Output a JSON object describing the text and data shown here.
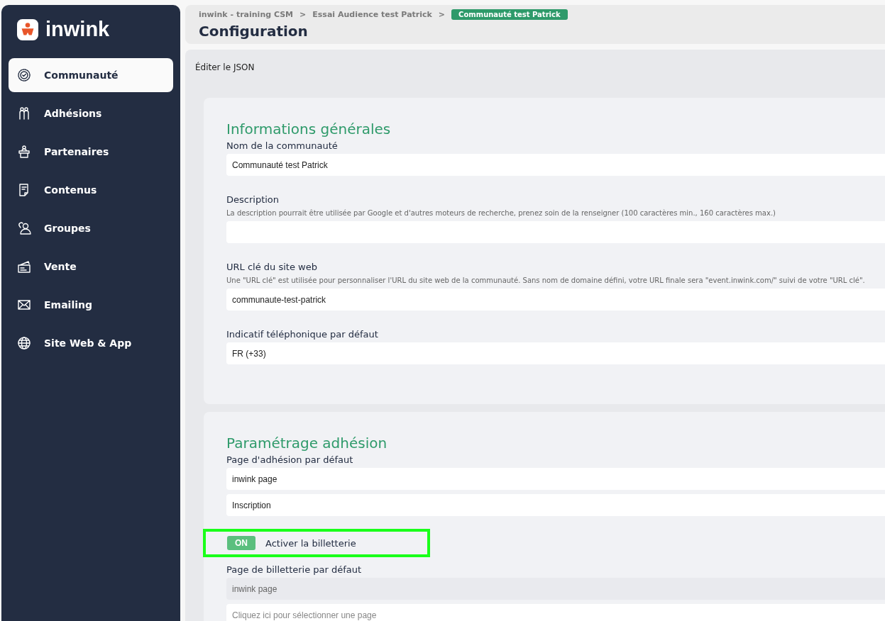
{
  "brand": {
    "name": "inwink"
  },
  "sidebar": {
    "items": [
      {
        "label": "Communauté",
        "selected": true
      },
      {
        "label": "Adhésions",
        "selected": false
      },
      {
        "label": "Partenaires",
        "selected": false
      },
      {
        "label": "Contenus",
        "selected": false
      },
      {
        "label": "Groupes",
        "selected": false
      },
      {
        "label": "Vente",
        "selected": false
      },
      {
        "label": "Emailing",
        "selected": false
      },
      {
        "label": "Site Web & App",
        "selected": false
      }
    ]
  },
  "breadcrumb": [
    {
      "label": "inwink - training CSM",
      "current": false
    },
    {
      "label": "Essai Audience test Patrick",
      "current": false
    },
    {
      "label": "Communauté test Patrick",
      "current": true
    }
  ],
  "breadcrumb_separator": ">",
  "page_title": "Configuration",
  "edit_json_link": "Éditer le JSON",
  "sections": [
    {
      "title": "Informations générales",
      "items": [
        {
          "kind": "field",
          "label": "Nom de la communauté",
          "inputs": [
            {
              "value": "Communauté test Patrick",
              "disabled": false
            }
          ]
        },
        {
          "kind": "field",
          "label": "Description",
          "hint": "La description pourrait être utilisée par Google et d'autres moteurs de recherche, prenez soin de la renseigner (100 caractères min., 160 caractères max.)",
          "inputs": [
            {
              "disabled": false
            }
          ]
        },
        {
          "kind": "field",
          "label": "URL clé du site web",
          "hint": "Une \"URL clé\" est utilisée pour personnaliser l'URL du site web de la communauté. Sans nom de domaine défini, votre URL finale sera \"event.inwink.com/\" suivi de votre \"URL clé\".",
          "inputs": [
            {
              "value": "communaute-test-patrick",
              "disabled": false
            }
          ]
        },
        {
          "kind": "field",
          "label": "Indicatif téléphonique par défaut",
          "inputs": [
            {
              "value": "FR (+33)",
              "disabled": false
            }
          ]
        }
      ]
    },
    {
      "title": "Paramétrage adhésion",
      "items": [
        {
          "kind": "field",
          "label": "Page d'adhésion par défaut",
          "inputs": [
            {
              "value": "inwink page",
              "disabled": false
            },
            {
              "value": "Inscription",
              "disabled": false
            }
          ]
        },
        {
          "kind": "toggle",
          "state_label": "ON",
          "on": true,
          "label": "Activer la billetterie",
          "highlighted": true
        },
        {
          "kind": "field",
          "label": "Page de billetterie par défaut",
          "inputs": [
            {
              "value": "inwink page",
              "disabled": true
            },
            {
              "placeholder": "Cliquez ici pour sélectionner une page",
              "disabled": false
            }
          ]
        }
      ]
    }
  ]
}
